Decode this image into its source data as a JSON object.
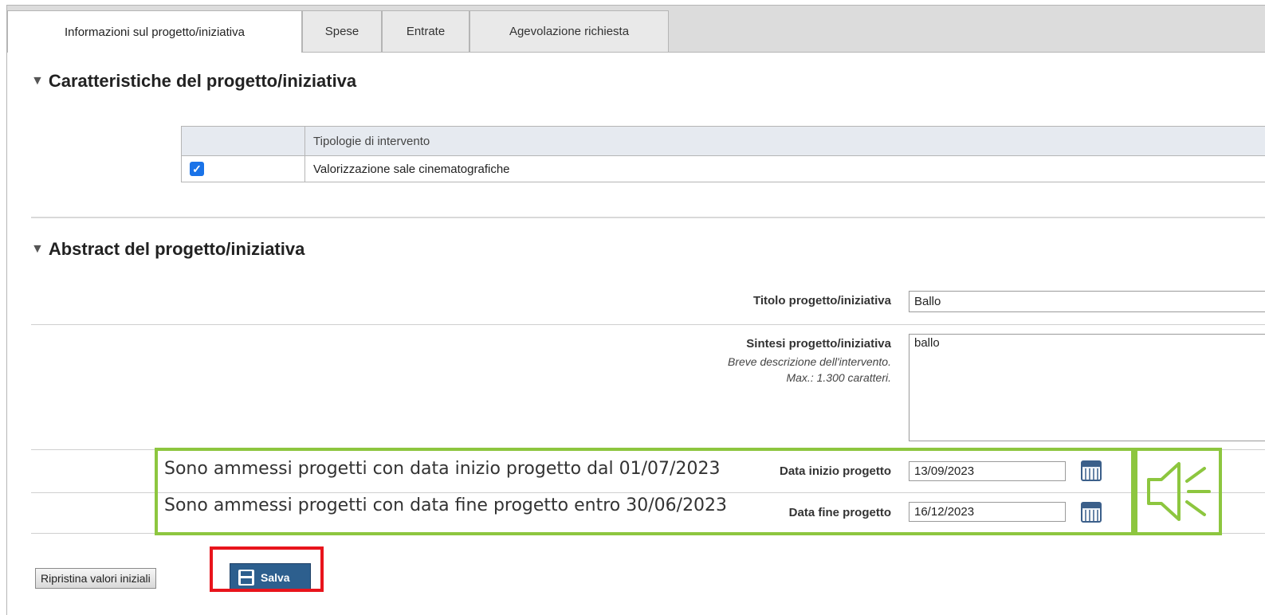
{
  "tabs": [
    {
      "label": "Informazioni sul progetto/iniziativa",
      "active": true
    },
    {
      "label": "Spese",
      "active": false
    },
    {
      "label": "Entrate",
      "active": false
    },
    {
      "label": "Agevolazione richiesta",
      "active": false
    }
  ],
  "section1": {
    "title": "Caratteristiche del progetto/iniziativa",
    "table_header": "Tipologie di intervento",
    "rows": [
      {
        "checked": true,
        "label": "Valorizzazione sale cinematografiche"
      }
    ]
  },
  "section2": {
    "title": "Abstract del progetto/iniziativa",
    "titolo_label": "Titolo progetto/iniziativa",
    "titolo_value": "Ballo",
    "sintesi_label": "Sintesi progetto/iniziativa",
    "sintesi_hint1": "Breve descrizione dell'intervento.",
    "sintesi_hint2": "Max.: 1.300 caratteri.",
    "sintesi_value": "ballo",
    "data_inizio_label": "Data inizio progetto",
    "data_inizio_value": "13/09/2023",
    "data_fine_label": "Data fine progetto",
    "data_fine_value": "16/12/2023"
  },
  "annotation": {
    "note_inizio": "Sono ammessi progetti con data inizio progetto dal 01/07/2023",
    "note_fine": "Sono ammessi progetti con data fine progetto entro 30/06/2023",
    "icon": "speaker-icon",
    "color": "#8dc63f"
  },
  "buttons": {
    "reset_label": "Ripristina valori iniziali",
    "save_label": "Salva"
  },
  "colors": {
    "highlight_red": "#e8141c",
    "save_button": "#2d5f8e"
  }
}
